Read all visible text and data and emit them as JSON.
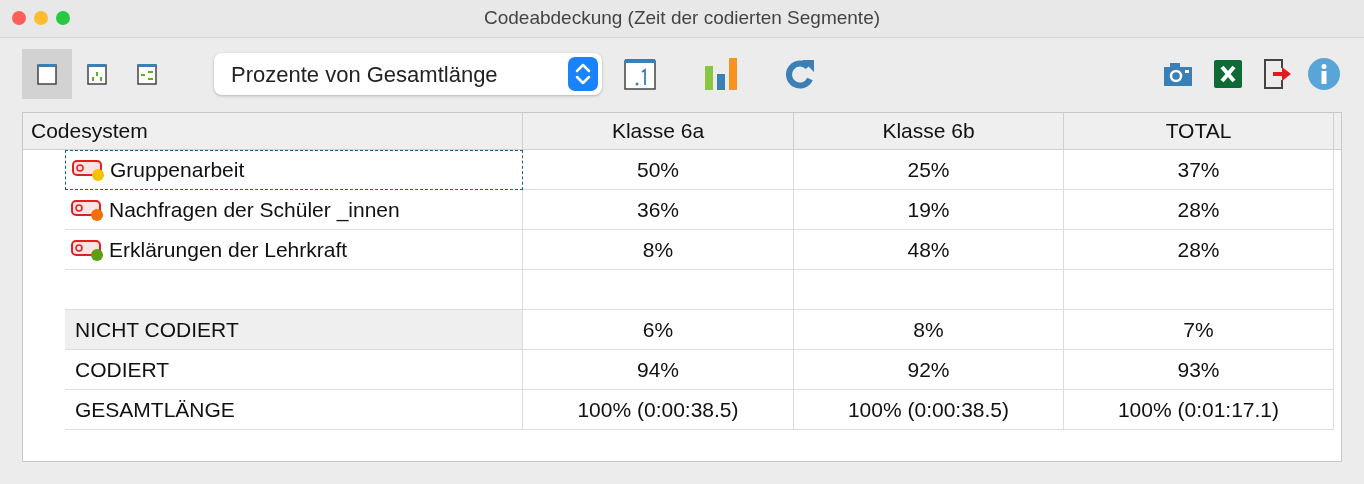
{
  "window": {
    "title": "Codeabdeckung (Zeit der codierten Segmente)"
  },
  "toolbar": {
    "view_buttons": [
      {
        "kind": "table",
        "selected": true
      },
      {
        "kind": "columns",
        "selected": false
      },
      {
        "kind": "rows",
        "selected": false
      }
    ],
    "mode_select": {
      "value": "Prozente von Gesamtlänge"
    }
  },
  "table": {
    "columns": [
      "Codesystem",
      "Klasse 6a",
      "Klasse 6b",
      "TOTAL"
    ],
    "code_rows": [
      {
        "label": "Gruppenarbeit",
        "color": "#f5c200",
        "focused": true,
        "values": [
          "50%",
          "25%",
          "37%"
        ]
      },
      {
        "label": "Nachfragen der Schüler _innen",
        "color": "#f07000",
        "focused": false,
        "values": [
          "36%",
          "19%",
          "28%"
        ]
      },
      {
        "label": "Erklärungen der Lehrkraft",
        "color": "#5aa010",
        "focused": false,
        "values": [
          "8%",
          "48%",
          "28%"
        ]
      }
    ],
    "summary_rows": [
      {
        "label": "NICHT CODIERT",
        "highlighted": true,
        "values": [
          "6%",
          "8%",
          "7%"
        ]
      },
      {
        "label": "CODIERT",
        "highlighted": false,
        "values": [
          "94%",
          "92%",
          "93%"
        ]
      },
      {
        "label": "GESAMTLÄNGE",
        "highlighted": false,
        "values": [
          "100% (0:00:38.5)",
          "100% (0:00:38.5)",
          "100% (0:01:17.1)"
        ]
      }
    ]
  }
}
